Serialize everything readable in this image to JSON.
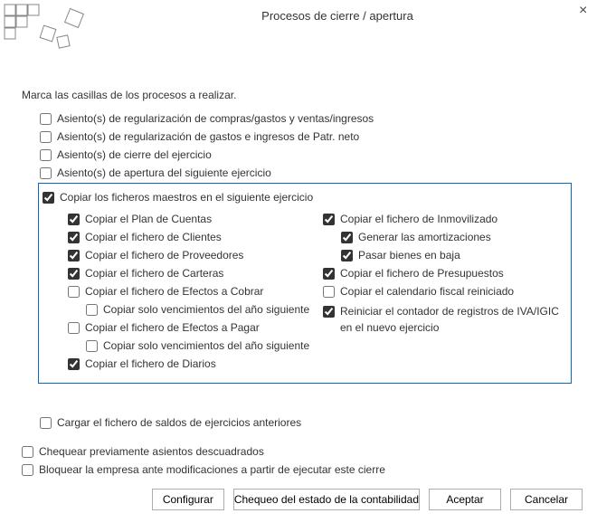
{
  "window": {
    "title": "Procesos de cierre / apertura"
  },
  "instruction": "Marca las casillas de los procesos a realizar.",
  "top_checks": {
    "regCompras": {
      "label": "Asiento(s) de regularización de compras/gastos y ventas/ingresos",
      "checked": false
    },
    "regPatr": {
      "label": "Asiento(s) de regularización de gastos e ingresos de Patr. neto",
      "checked": false
    },
    "cierre": {
      "label": "Asiento(s) de cierre del ejercicio",
      "checked": false
    },
    "apertura": {
      "label": "Asiento(s) de apertura del siguiente ejercicio",
      "checked": false
    }
  },
  "copy_master": {
    "header": {
      "label": "Copiar los ficheros maestros en el siguiente ejercicio",
      "checked": true
    },
    "left": {
      "plan": {
        "label": "Copiar el Plan de Cuentas",
        "checked": true
      },
      "clientes": {
        "label": "Copiar el fichero de Clientes",
        "checked": true
      },
      "provee": {
        "label": "Copiar el fichero de Proveedores",
        "checked": true
      },
      "carteras": {
        "label": "Copiar el fichero de Carteras",
        "checked": true
      },
      "efCobrar": {
        "label": "Copiar el fichero de Efectos a Cobrar",
        "checked": false
      },
      "venc1": {
        "label": "Copiar solo vencimientos del año siguiente",
        "checked": false
      },
      "efPagar": {
        "label": "Copiar el fichero de Efectos a Pagar",
        "checked": false
      },
      "venc2": {
        "label": "Copiar solo vencimientos del año siguiente",
        "checked": false
      },
      "diarios": {
        "label": "Copiar el fichero de Diarios",
        "checked": true
      }
    },
    "right": {
      "inmov": {
        "label": "Copiar el fichero de Inmovilizado",
        "checked": true
      },
      "amort": {
        "label": "Generar las amortizaciones",
        "checked": true
      },
      "baja": {
        "label": "Pasar bienes en baja",
        "checked": true
      },
      "presu": {
        "label": "Copiar el fichero de Presupuestos",
        "checked": true
      },
      "calfisc": {
        "label": "Copiar el calendario fiscal reiniciado",
        "checked": false
      },
      "ivaigic": {
        "label": "Reiniciar el contador de registros de IVA/IGIC en el nuevo ejercicio",
        "checked": true
      }
    }
  },
  "bottom_checks": {
    "saldos": {
      "label": "Cargar el fichero de saldos de ejercicios anteriores",
      "checked": false
    },
    "chequeo": {
      "label": "Chequear previamente asientos descuadrados",
      "checked": false
    },
    "bloqueo": {
      "label": "Bloquear la empresa ante modificaciones a partir de ejecutar este cierre",
      "checked": false
    }
  },
  "buttons": {
    "config": "Configurar",
    "chequeo": "Chequeo del estado de la contabilidad",
    "aceptar": "Aceptar",
    "cancel": "Cancelar"
  }
}
